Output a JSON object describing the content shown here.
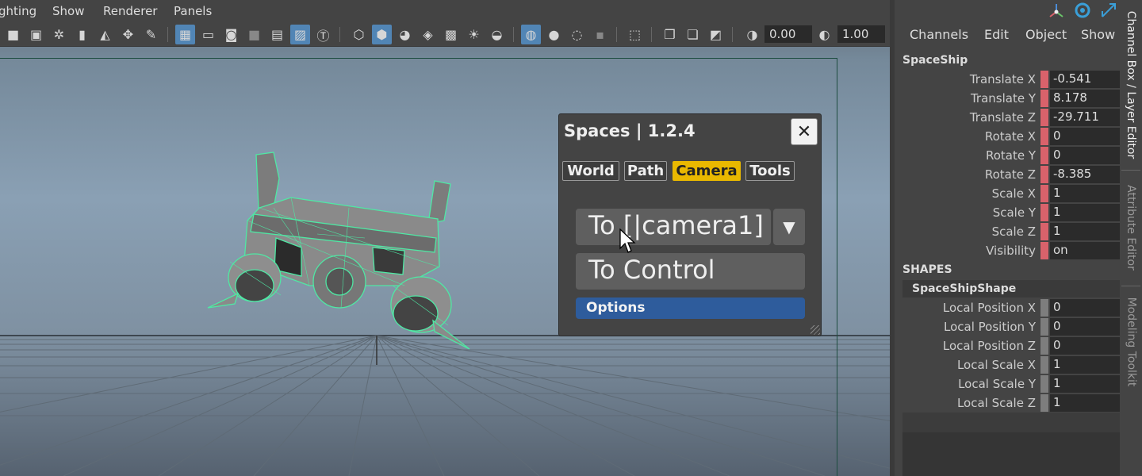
{
  "menubar": {
    "items": [
      "ghting",
      "Show",
      "Renderer",
      "Panels"
    ]
  },
  "toolbar": {
    "exposure_value": "0.00",
    "gamma_value": "1.00"
  },
  "spaces_window": {
    "title": "Spaces | 1.2.4",
    "close_glyph": "✕",
    "tabs": [
      {
        "label": "World",
        "active": false
      },
      {
        "label": "Path",
        "active": false
      },
      {
        "label": "Camera",
        "active": true
      },
      {
        "label": "Tools",
        "active": false
      }
    ],
    "to_camera_label": "To [|camera1]",
    "dropdown_glyph": "▼",
    "to_control_label": "To Control",
    "options_label": "Options"
  },
  "channel_box": {
    "menus": [
      "Channels",
      "Edit",
      "Object",
      "Show"
    ],
    "object_name": "SpaceShip",
    "attributes": [
      {
        "label": "Translate X",
        "value": "-0.541"
      },
      {
        "label": "Translate Y",
        "value": "8.178"
      },
      {
        "label": "Translate Z",
        "value": "-29.711"
      },
      {
        "label": "Rotate X",
        "value": "0"
      },
      {
        "label": "Rotate Y",
        "value": "0"
      },
      {
        "label": "Rotate Z",
        "value": "-8.385"
      },
      {
        "label": "Scale X",
        "value": "1"
      },
      {
        "label": "Scale Y",
        "value": "1"
      },
      {
        "label": "Scale Z",
        "value": "1"
      },
      {
        "label": "Visibility",
        "value": "on"
      }
    ],
    "shapes_header": "SHAPES",
    "shape_name": "SpaceShipShape",
    "shape_attributes": [
      {
        "label": "Local Position X",
        "value": "0"
      },
      {
        "label": "Local Position Y",
        "value": "0"
      },
      {
        "label": "Local Position Z",
        "value": "0"
      },
      {
        "label": "Local Scale X",
        "value": "1"
      },
      {
        "label": "Local Scale Y",
        "value": "1"
      },
      {
        "label": "Local Scale Z",
        "value": "1"
      }
    ]
  },
  "side_tabs": [
    {
      "label": "Channel Box / Layer Editor",
      "active": true
    },
    {
      "label": "Attribute Editor",
      "active": false
    },
    {
      "label": "Modeling Toolkit",
      "active": false
    }
  ],
  "colors": {
    "selected_tab": "#e9b800",
    "options_button": "#2e5c9c",
    "keyed_attribute": "#d9626b",
    "wireframe": "#4fe8a4",
    "toolbar_active": "#5185b5"
  }
}
